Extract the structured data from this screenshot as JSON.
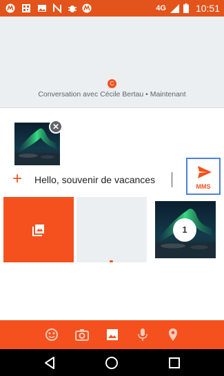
{
  "status_bar": {
    "network": "4G",
    "time": "10:51",
    "icons": [
      "moto-icon",
      "qr-icon",
      "image-icon",
      "n-icon",
      "bug-icon",
      "moto-icon",
      "signal-icon",
      "battery-icon"
    ]
  },
  "conversation": {
    "avatar_letter": "C",
    "info": "Conversation avec Cécile Bertau • Maintenant"
  },
  "compose": {
    "message": "Hello, souvenir de vacances",
    "send_label": "MMS"
  },
  "media_picker": {
    "selected_count": "1"
  },
  "toolbar": {
    "items": [
      "emoji-icon",
      "camera-icon",
      "gallery-icon",
      "microphone-icon",
      "location-icon"
    ]
  },
  "colors": {
    "accent": "#f4511e",
    "status_bar": "#e2541b",
    "focus_outline": "#4a7fe0"
  }
}
